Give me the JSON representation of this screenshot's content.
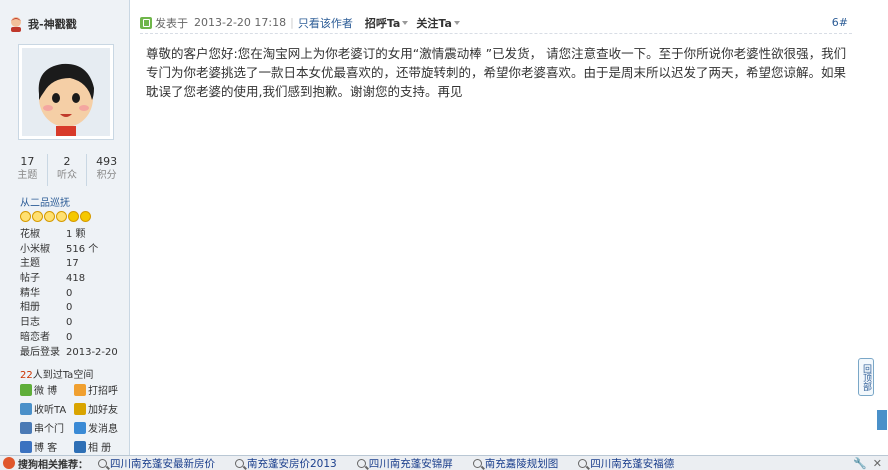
{
  "user": {
    "name": "我-神戳戳",
    "stats": [
      {
        "value": "17",
        "label": "主题"
      },
      {
        "value": "2",
        "label": "听众"
      },
      {
        "value": "493",
        "label": "积分"
      }
    ],
    "rank_title": "从二品巡抚",
    "info": [
      {
        "key": "花椒",
        "value": "1 颗"
      },
      {
        "key": "小米椒",
        "value": "516 个"
      },
      {
        "key": "主题",
        "value": "17"
      },
      {
        "key": "帖子",
        "value": "418"
      },
      {
        "key": "精华",
        "value": "0"
      },
      {
        "key": "相册",
        "value": "0"
      },
      {
        "key": "日志",
        "value": "0"
      },
      {
        "key": "暗恋者",
        "value": "0"
      },
      {
        "key": "最后登录",
        "value": "2013-2-20"
      }
    ],
    "visitors_count": "22",
    "visitors_text": "人到过Ta空间",
    "actions": [
      {
        "label": "微 博",
        "color": "#5fae3a"
      },
      {
        "label": "打招呼",
        "color": "#f0a030"
      },
      {
        "label": "收听TA",
        "color": "#4a90c9"
      },
      {
        "label": "加好友",
        "color": "#d9a400"
      },
      {
        "label": "串个门",
        "color": "#4a7ab5"
      },
      {
        "label": "发消息",
        "color": "#3a8ad5"
      },
      {
        "label": "博 客",
        "color": "#3b72c0"
      },
      {
        "label": "相 册",
        "color": "#2e6fb5"
      }
    ]
  },
  "post": {
    "posted_label": "发表于",
    "posted_time": "2013-2-20 17:18",
    "sep": "|",
    "author_only": "只看该作者",
    "greet_label": "招呼Ta",
    "follow_label": "关注Ta",
    "floor": "6#",
    "body": "尊敬的客户您好:您在淘宝网上为你老婆订的女用“激情震动棒 ”已发货， 请您注意查收一下。至于你所说你老婆性欲很强，我们专门为你老婆挑选了一款日本女优最喜欢的，还带旋转刺的，希望你老婆喜欢。由于是周末所以迟发了两天，希望您谅解。如果耽误了您老婆的使用,我们感到抱歉。谢谢您的支持。再见"
  },
  "back_to_top": "回顶部",
  "bottom_bar": {
    "title": "搜狗相关推荐：",
    "links": [
      "四川南充蓬安最新房价",
      "南充蓬安房价2013",
      "四川南充蓬安锦屏",
      "南充嘉陵规划图",
      "四川南充蓬安福德"
    ],
    "tools": [
      "🔧",
      "✕"
    ]
  }
}
